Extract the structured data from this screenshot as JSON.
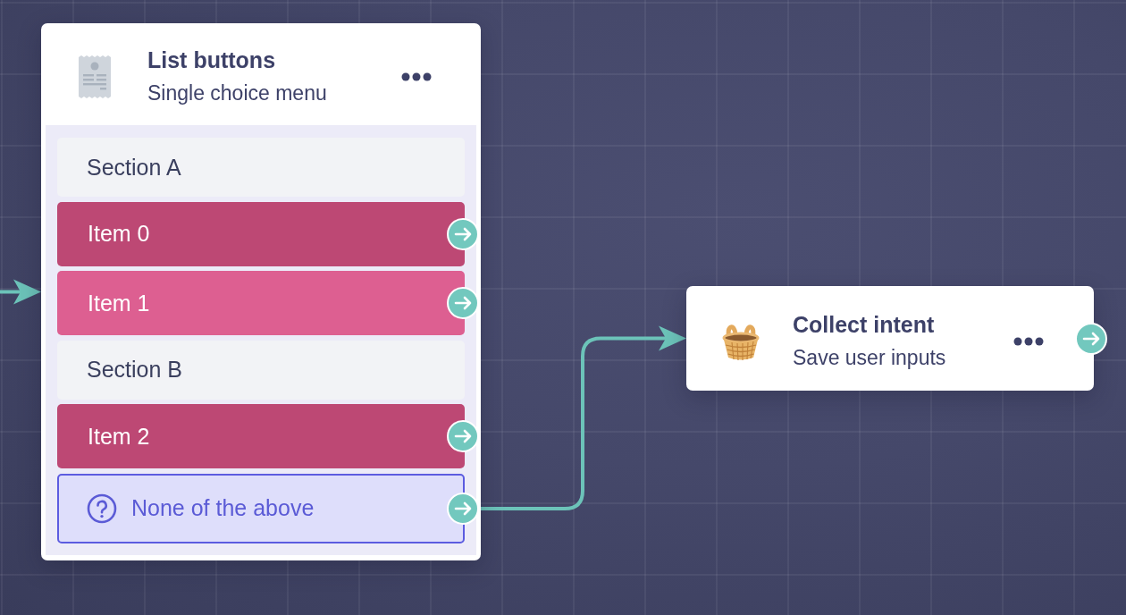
{
  "canvas": {
    "entry_arrow": true,
    "nodes": [
      {
        "kind": "list",
        "title": "List buttons",
        "subtitle": "Single choice menu",
        "rows": [
          {
            "kind": "section",
            "label": "Section A",
            "connected": false
          },
          {
            "kind": "item",
            "label": "Item 0",
            "color": "#bd4874",
            "connected": false
          },
          {
            "kind": "item",
            "label": "Item 1",
            "color": "#dd5f91",
            "connected": false
          },
          {
            "kind": "section",
            "label": "Section B",
            "connected": false
          },
          {
            "kind": "item",
            "label": "Item 2",
            "color": "#bd4874",
            "connected": false
          },
          {
            "kind": "fallback",
            "label": "None of the above",
            "connected": true
          }
        ]
      },
      {
        "kind": "step",
        "title": "Collect intent",
        "subtitle": "Save user inputs"
      }
    ]
  }
}
